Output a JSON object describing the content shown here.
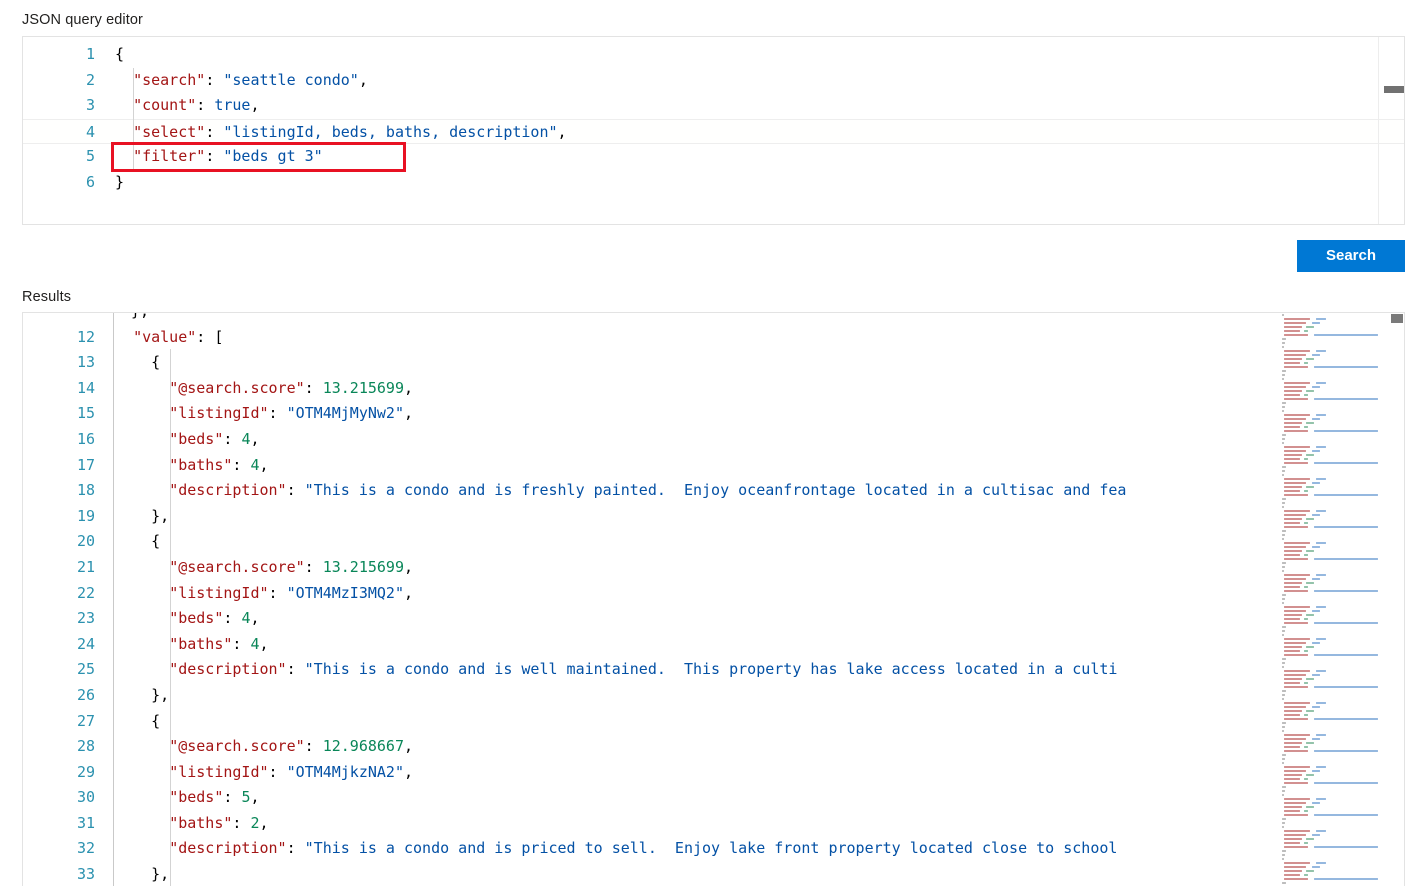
{
  "labels": {
    "editor": "JSON query editor",
    "results": "Results"
  },
  "toolbar": {
    "search_label": "Search"
  },
  "colors": {
    "accent": "#0078D4",
    "annotation": "#E81123",
    "key": "#A31515",
    "string": "#0451A5",
    "number": "#098658",
    "line_number": "#2B91AF"
  },
  "query_editor": {
    "lines": [
      {
        "no": "1",
        "current": false,
        "tokens": [
          {
            "t": "{",
            "c": "p"
          }
        ]
      },
      {
        "no": "2",
        "current": false,
        "tokens": [
          {
            "t": "  ",
            "c": "p"
          },
          {
            "t": "\"search\"",
            "c": "k"
          },
          {
            "t": ": ",
            "c": "p"
          },
          {
            "t": "\"seattle condo\"",
            "c": "s"
          },
          {
            "t": ",",
            "c": "p"
          }
        ]
      },
      {
        "no": "3",
        "current": false,
        "tokens": [
          {
            "t": "  ",
            "c": "p"
          },
          {
            "t": "\"count\"",
            "c": "k"
          },
          {
            "t": ": ",
            "c": "p"
          },
          {
            "t": "true",
            "c": "b"
          },
          {
            "t": ",",
            "c": "p"
          }
        ]
      },
      {
        "no": "4",
        "current": true,
        "tokens": [
          {
            "t": "  ",
            "c": "p"
          },
          {
            "t": "\"select\"",
            "c": "k"
          },
          {
            "t": ": ",
            "c": "p"
          },
          {
            "t": "\"listingId, beds, baths, description\"",
            "c": "s"
          },
          {
            "t": ",",
            "c": "p"
          }
        ]
      },
      {
        "no": "5",
        "current": false,
        "tokens": [
          {
            "t": "  ",
            "c": "p"
          },
          {
            "t": "\"filter\"",
            "c": "k"
          },
          {
            "t": ": ",
            "c": "p"
          },
          {
            "t": "\"beds gt 3\"",
            "c": "s"
          }
        ]
      },
      {
        "no": "6",
        "current": false,
        "tokens": [
          {
            "t": "}",
            "c": "p"
          }
        ]
      }
    ]
  },
  "results_editor": {
    "clipped_top_line": "},",
    "lines": [
      {
        "no": "12",
        "tokens": [
          {
            "t": "  ",
            "c": "p"
          },
          {
            "t": "\"value\"",
            "c": "k"
          },
          {
            "t": ": [",
            "c": "p"
          }
        ]
      },
      {
        "no": "13",
        "tokens": [
          {
            "t": "    {",
            "c": "p"
          }
        ]
      },
      {
        "no": "14",
        "tokens": [
          {
            "t": "      ",
            "c": "p"
          },
          {
            "t": "\"@search.score\"",
            "c": "k"
          },
          {
            "t": ": ",
            "c": "p"
          },
          {
            "t": "13.215699",
            "c": "n"
          },
          {
            "t": ",",
            "c": "p"
          }
        ]
      },
      {
        "no": "15",
        "tokens": [
          {
            "t": "      ",
            "c": "p"
          },
          {
            "t": "\"listingId\"",
            "c": "k"
          },
          {
            "t": ": ",
            "c": "p"
          },
          {
            "t": "\"OTM4MjMyNw2\"",
            "c": "s"
          },
          {
            "t": ",",
            "c": "p"
          }
        ]
      },
      {
        "no": "16",
        "tokens": [
          {
            "t": "      ",
            "c": "p"
          },
          {
            "t": "\"beds\"",
            "c": "k"
          },
          {
            "t": ": ",
            "c": "p"
          },
          {
            "t": "4",
            "c": "n"
          },
          {
            "t": ",",
            "c": "p"
          }
        ]
      },
      {
        "no": "17",
        "tokens": [
          {
            "t": "      ",
            "c": "p"
          },
          {
            "t": "\"baths\"",
            "c": "k"
          },
          {
            "t": ": ",
            "c": "p"
          },
          {
            "t": "4",
            "c": "n"
          },
          {
            "t": ",",
            "c": "p"
          }
        ]
      },
      {
        "no": "18",
        "tokens": [
          {
            "t": "      ",
            "c": "p"
          },
          {
            "t": "\"description\"",
            "c": "k"
          },
          {
            "t": ": ",
            "c": "p"
          },
          {
            "t": "\"This is a condo and is freshly painted.  Enjoy oceanfrontage located in a cultisac and fea",
            "c": "s"
          }
        ]
      },
      {
        "no": "19",
        "tokens": [
          {
            "t": "    },",
            "c": "p"
          }
        ]
      },
      {
        "no": "20",
        "tokens": [
          {
            "t": "    {",
            "c": "p"
          }
        ]
      },
      {
        "no": "21",
        "tokens": [
          {
            "t": "      ",
            "c": "p"
          },
          {
            "t": "\"@search.score\"",
            "c": "k"
          },
          {
            "t": ": ",
            "c": "p"
          },
          {
            "t": "13.215699",
            "c": "n"
          },
          {
            "t": ",",
            "c": "p"
          }
        ]
      },
      {
        "no": "22",
        "tokens": [
          {
            "t": "      ",
            "c": "p"
          },
          {
            "t": "\"listingId\"",
            "c": "k"
          },
          {
            "t": ": ",
            "c": "p"
          },
          {
            "t": "\"OTM4MzI3MQ2\"",
            "c": "s"
          },
          {
            "t": ",",
            "c": "p"
          }
        ]
      },
      {
        "no": "23",
        "tokens": [
          {
            "t": "      ",
            "c": "p"
          },
          {
            "t": "\"beds\"",
            "c": "k"
          },
          {
            "t": ": ",
            "c": "p"
          },
          {
            "t": "4",
            "c": "n"
          },
          {
            "t": ",",
            "c": "p"
          }
        ]
      },
      {
        "no": "24",
        "tokens": [
          {
            "t": "      ",
            "c": "p"
          },
          {
            "t": "\"baths\"",
            "c": "k"
          },
          {
            "t": ": ",
            "c": "p"
          },
          {
            "t": "4",
            "c": "n"
          },
          {
            "t": ",",
            "c": "p"
          }
        ]
      },
      {
        "no": "25",
        "tokens": [
          {
            "t": "      ",
            "c": "p"
          },
          {
            "t": "\"description\"",
            "c": "k"
          },
          {
            "t": ": ",
            "c": "p"
          },
          {
            "t": "\"This is a condo and is well maintained.  This property has lake access located in a culti",
            "c": "s"
          }
        ]
      },
      {
        "no": "26",
        "tokens": [
          {
            "t": "    },",
            "c": "p"
          }
        ]
      },
      {
        "no": "27",
        "tokens": [
          {
            "t": "    {",
            "c": "p"
          }
        ]
      },
      {
        "no": "28",
        "tokens": [
          {
            "t": "      ",
            "c": "p"
          },
          {
            "t": "\"@search.score\"",
            "c": "k"
          },
          {
            "t": ": ",
            "c": "p"
          },
          {
            "t": "12.968667",
            "c": "n"
          },
          {
            "t": ",",
            "c": "p"
          }
        ]
      },
      {
        "no": "29",
        "tokens": [
          {
            "t": "      ",
            "c": "p"
          },
          {
            "t": "\"listingId\"",
            "c": "k"
          },
          {
            "t": ": ",
            "c": "p"
          },
          {
            "t": "\"OTM4MjkzNA2\"",
            "c": "s"
          },
          {
            "t": ",",
            "c": "p"
          }
        ]
      },
      {
        "no": "30",
        "tokens": [
          {
            "t": "      ",
            "c": "p"
          },
          {
            "t": "\"beds\"",
            "c": "k"
          },
          {
            "t": ": ",
            "c": "p"
          },
          {
            "t": "5",
            "c": "n"
          },
          {
            "t": ",",
            "c": "p"
          }
        ]
      },
      {
        "no": "31",
        "tokens": [
          {
            "t": "      ",
            "c": "p"
          },
          {
            "t": "\"baths\"",
            "c": "k"
          },
          {
            "t": ": ",
            "c": "p"
          },
          {
            "t": "2",
            "c": "n"
          },
          {
            "t": ",",
            "c": "p"
          }
        ]
      },
      {
        "no": "32",
        "tokens": [
          {
            "t": "      ",
            "c": "p"
          },
          {
            "t": "\"description\"",
            "c": "k"
          },
          {
            "t": ": ",
            "c": "p"
          },
          {
            "t": "\"This is a condo and is priced to sell.  Enjoy lake front property located close to school",
            "c": "s"
          }
        ]
      },
      {
        "no": "33",
        "tokens": [
          {
            "t": "    },",
            "c": "p"
          }
        ]
      }
    ]
  },
  "annotation": {
    "target_line": "5",
    "target_text": "\"filter\": \"beds gt 3\""
  }
}
